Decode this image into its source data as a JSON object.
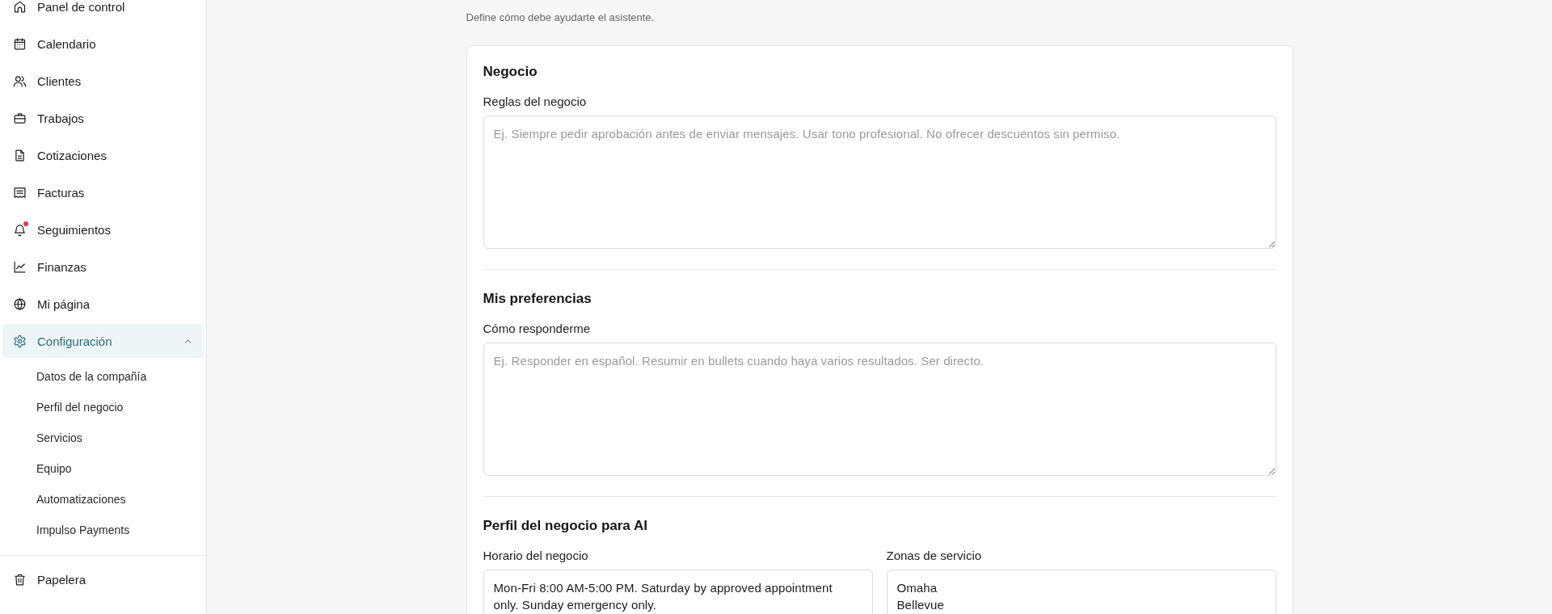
{
  "sidebar": {
    "items": [
      {
        "label": "Panel de control",
        "selected": false,
        "notification": false
      },
      {
        "label": "Calendario",
        "selected": false,
        "notification": false
      },
      {
        "label": "Clientes",
        "selected": false,
        "notification": false
      },
      {
        "label": "Trabajos",
        "selected": false,
        "notification": false
      },
      {
        "label": "Cotizaciones",
        "selected": false,
        "notification": false
      },
      {
        "label": "Facturas",
        "selected": false,
        "notification": false
      },
      {
        "label": "Seguimientos",
        "selected": false,
        "notification": true
      },
      {
        "label": "Finanzas",
        "selected": false,
        "notification": false
      },
      {
        "label": "Mi página",
        "selected": false,
        "notification": false
      },
      {
        "label": "Configuración",
        "selected": true,
        "notification": false,
        "expanded": true,
        "children": [
          {
            "label": "Datos de la compañía",
            "selected": false
          },
          {
            "label": "Perfil del negocio",
            "selected": false
          },
          {
            "label": "Servicios",
            "selected": false
          },
          {
            "label": "Equipo",
            "selected": false
          },
          {
            "label": "Automatizaciones",
            "selected": false
          },
          {
            "label": "Impulso Payments",
            "selected": false
          }
        ]
      }
    ],
    "bottom_items": [
      {
        "label": "Papelera",
        "selected": false
      }
    ]
  },
  "page": {
    "subtitle": "Define cómo debe ayudarte el asistente."
  },
  "sections": [
    {
      "title": "Negocio",
      "fields": [
        {
          "label": "Reglas del negocio",
          "placeholder": "Ej. Siempre pedir aprobación antes de enviar mensajes. Usar tono profesional. No ofrecer descuentos sin permiso."
        }
      ]
    },
    {
      "title": "Mis preferencias",
      "fields": [
        {
          "label": "Cómo responderme",
          "placeholder": "Ej. Responder en español. Resumir en bullets cuando haya varios resultados. Ser directo."
        }
      ]
    },
    {
      "title": "Perfil del negocio para AI",
      "fields": [
        {
          "label": "Horario del negocio",
          "value": "Mon-Fri 8:00 AM-5:00 PM. Saturday by approved appointment only. Sunday emergency only."
        },
        {
          "label": "Zonas de servicio",
          "value": "Omaha\nBellevue"
        }
      ]
    }
  ]
}
